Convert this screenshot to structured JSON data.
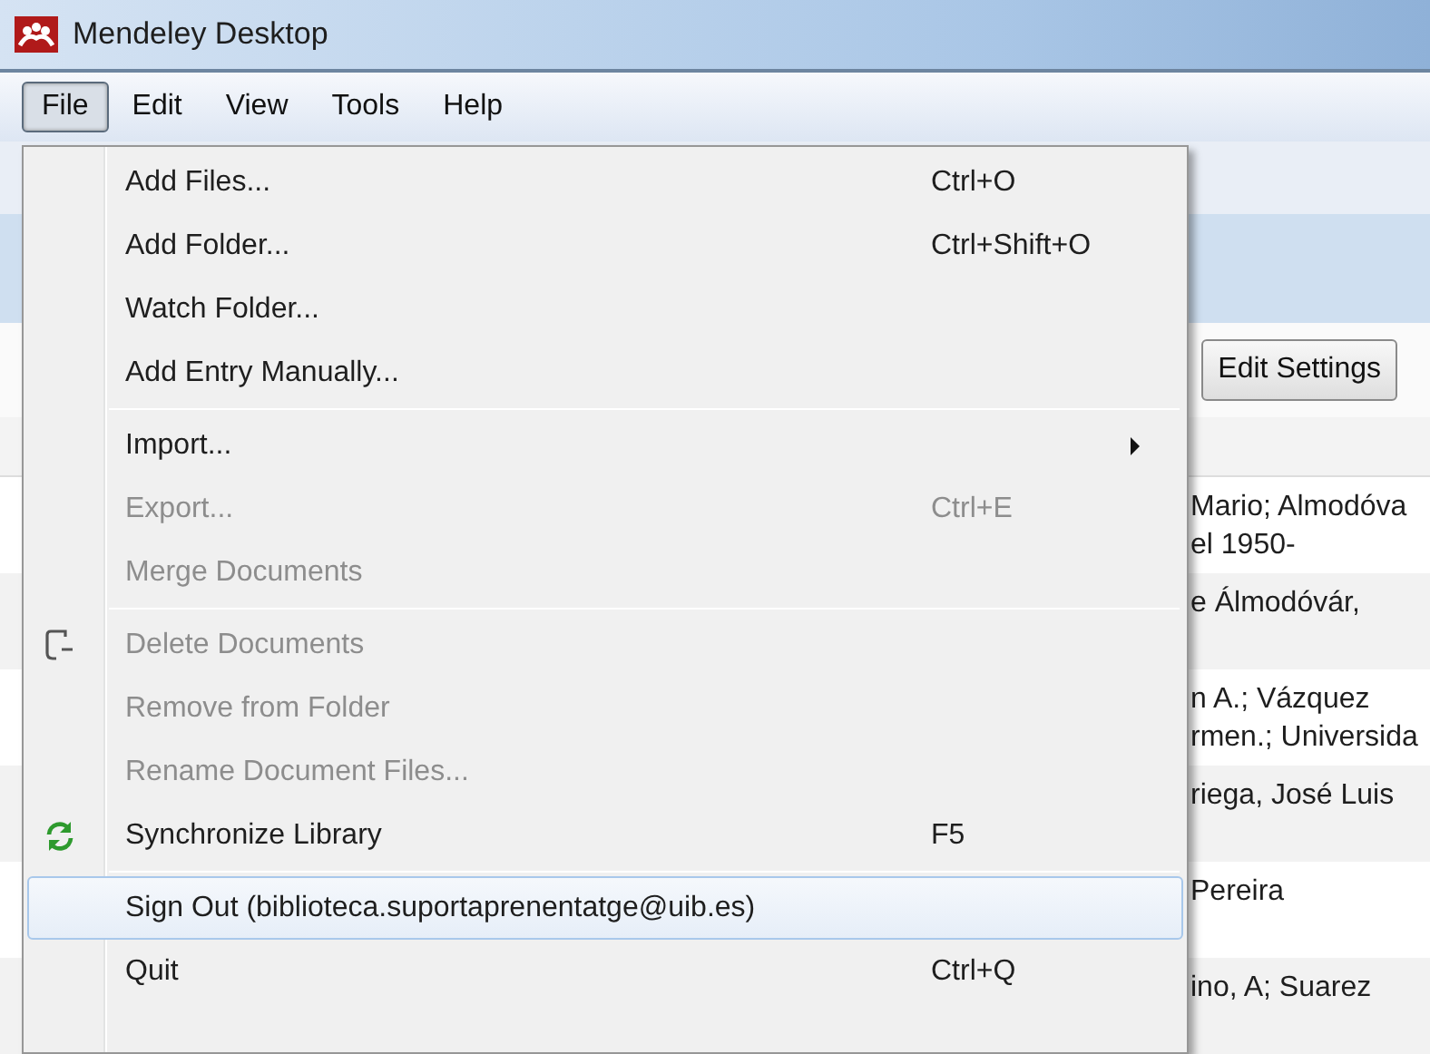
{
  "window": {
    "title": "Mendeley Desktop"
  },
  "menubar": [
    {
      "label": "File",
      "selected": true
    },
    {
      "label": "Edit",
      "selected": false
    },
    {
      "label": "View",
      "selected": false
    },
    {
      "label": "Tools",
      "selected": false
    },
    {
      "label": "Help",
      "selected": false
    }
  ],
  "toolbar": {
    "button": "Edit Settings"
  },
  "rows": [
    {
      "lines": [
        "Mario; Almodóva",
        "el 1950-"
      ]
    },
    {
      "lines": [
        "e Álmodóvár,"
      ]
    },
    {
      "lines": [
        "n A.; Vázquez",
        "rmen.; Universida"
      ]
    },
    {
      "lines": [
        "riega, José Luis"
      ]
    },
    {
      "lines": [
        "Pereira"
      ]
    },
    {
      "lines": [
        "ino, A; Suarez"
      ]
    }
  ],
  "file_menu": [
    [
      {
        "label": "Add Files...",
        "shortcut": "Ctrl+O",
        "disabled": false,
        "selected": false
      },
      {
        "label": "Add Folder...",
        "shortcut": "Ctrl+Shift+O",
        "disabled": false,
        "selected": false
      },
      {
        "label": "Watch Folder...",
        "disabled": false,
        "selected": false
      },
      {
        "label": "Add Entry Manually...",
        "disabled": false,
        "selected": false
      }
    ],
    [
      {
        "label": "Import...",
        "disabled": false,
        "selected": false,
        "submenu": true
      },
      {
        "label": "Export...",
        "shortcut": "Ctrl+E",
        "disabled": true,
        "selected": false
      },
      {
        "label": "Merge Documents",
        "disabled": true,
        "selected": false
      }
    ],
    [
      {
        "label": "Delete Documents",
        "disabled": true,
        "selected": false,
        "kind": "document"
      },
      {
        "label": "Remove from Folder",
        "disabled": true,
        "selected": false
      },
      {
        "label": "Rename Document Files...",
        "disabled": true,
        "selected": false
      },
      {
        "label": "Synchronize Library",
        "shortcut": "F5",
        "disabled": false,
        "selected": false,
        "kind": "sync"
      }
    ],
    [
      {
        "label": "Sign Out (biblioteca.suportaprenentatge@uib.es)",
        "disabled": false,
        "selected": true
      },
      {
        "label": "Quit",
        "shortcut": "Ctrl+Q",
        "disabled": false,
        "selected": false
      }
    ]
  ]
}
